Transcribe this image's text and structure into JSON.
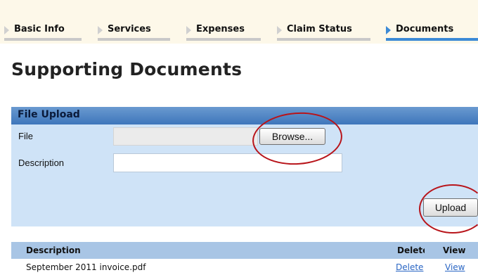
{
  "tabs": [
    {
      "label": "Basic Info",
      "active": false
    },
    {
      "label": "Services",
      "active": false
    },
    {
      "label": "Expenses",
      "active": false
    },
    {
      "label": "Claim Status",
      "active": false
    },
    {
      "label": "Documents",
      "active": true
    }
  ],
  "page_title": "Supporting Documents",
  "file_upload": {
    "title": "File Upload",
    "file_label": "File",
    "file_value": "",
    "browse_label": "Browse...",
    "description_label": "Description",
    "description_value": "",
    "upload_label": "Upload"
  },
  "documents_table": {
    "columns": [
      "Description",
      "Delete",
      "View"
    ],
    "rows": [
      {
        "description": "September 2011 invoice.pdf",
        "delete": "Delete",
        "view": "View"
      }
    ]
  },
  "colors": {
    "active_tab": "#3c8ad6",
    "panel_background": "#cfe3f7",
    "panel_header": "#3e76bb",
    "table_header": "#a8c5e5",
    "annotation": "#b8141a",
    "link": "#2a66c4"
  },
  "icons": [
    "tab-arrow-icon"
  ]
}
